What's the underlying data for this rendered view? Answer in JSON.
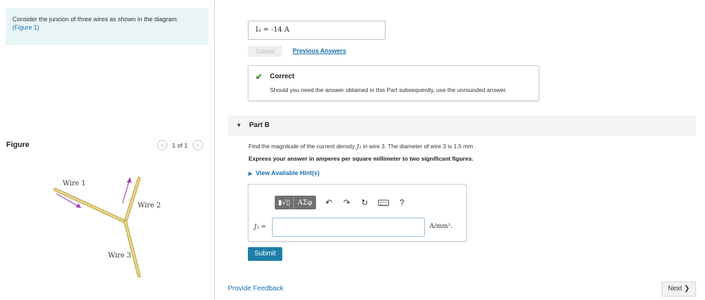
{
  "prompt": {
    "text": "Consider the juncion of three wires as shown in the diagram.",
    "figure_link": "(Figure 1)"
  },
  "figure_panel": {
    "label": "Figure",
    "prev_icon": "chevron-left-icon",
    "next_icon": "chevron-right-icon",
    "counter": "1 of 1",
    "wire_labels": [
      "Wire 1",
      "Wire 2",
      "Wire 3"
    ]
  },
  "part_a": {
    "answer_text": "I₃ =  -14  A",
    "submit_label": "Submit",
    "previous_answers_label": "Previous Answers",
    "feedback": {
      "icon": "checkmark-icon",
      "title": "Correct",
      "message": "Should you need the answer obtained in this Part subsequently, use the unrounded answer."
    }
  },
  "part_b": {
    "title": "Part B",
    "question_start": "Find the magnitude of the current density ",
    "question_symbol": "J₃",
    "question_end": " in wire 3. The diameter of wire 3 is 1.5 mm .",
    "instruction": "Express your answer in amperes per square millimeter to two significant figures.",
    "hints_label": "View Available Hint(s)",
    "toolbar": {
      "template_label": "▮√▯",
      "symbols_label": "ΑΣφ",
      "icons": [
        "undo-icon",
        "redo-icon",
        "reset-icon",
        "keyboard-icon",
        "help-icon"
      ],
      "help_label": "?"
    },
    "input_label": "J₃ =",
    "input_value": "",
    "units": "A/mm².",
    "submit_label": "Submit"
  },
  "footer": {
    "feedback_link": "Provide Feedback",
    "next_label": "Next"
  },
  "colors": {
    "accent": "#1b7fa8",
    "link": "#1a6fb0",
    "correct": "#3a8a2e",
    "wire": "#e3c86a",
    "arrow": "#9b45b8"
  }
}
